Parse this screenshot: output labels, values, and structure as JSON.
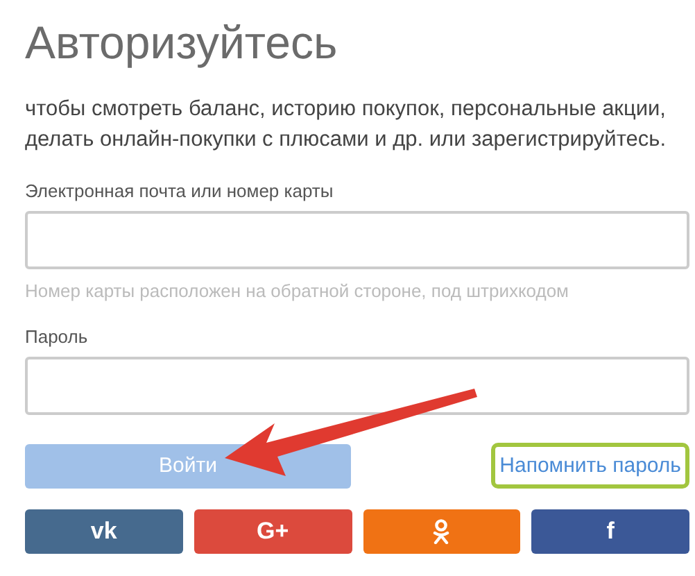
{
  "title": "Авторизуйтесь",
  "description": "чтобы смотреть баланс, историю покупок, персональные акции, делать онлайн-покупки с плюсами и др. или зарегистрируйтесь.",
  "fields": [
    {
      "label": "Электронная почта или номер карты",
      "hint": "Номер карты расположен на обратной стороне, под штрихкодом"
    },
    {
      "label": "Пароль"
    }
  ],
  "login_button": {
    "label": "Войти",
    "disabled": true
  },
  "remind_link": {
    "label": "Напомнить пароль",
    "highlighted": true
  },
  "social_buttons": [
    {
      "kind": "vk",
      "label": "vk"
    },
    {
      "kind": "google",
      "label": "G+"
    },
    {
      "kind": "ok"
    },
    {
      "kind": "facebook",
      "label": "f"
    }
  ]
}
